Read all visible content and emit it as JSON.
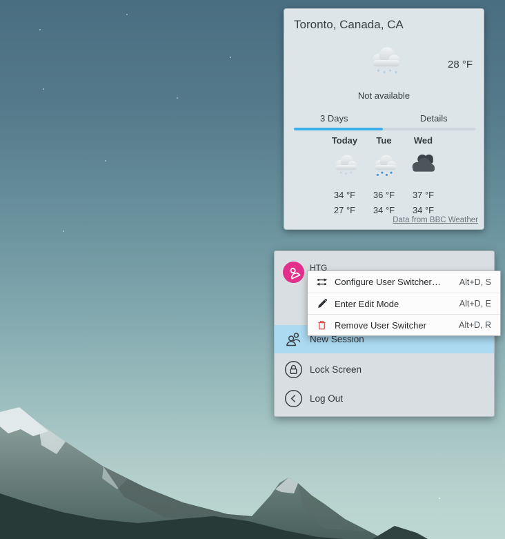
{
  "wallpaper": {
    "sky_top_color": "#4a6e81",
    "sky_bottom_color": "#bed7d3"
  },
  "weather": {
    "title": "Toronto, Canada, CA",
    "accent": "#3daee9",
    "current": {
      "icon": "snow-cloud-icon",
      "temperature": "28 °F",
      "condition": "Not available"
    },
    "tabs": [
      {
        "label": "3 Days",
        "active": true
      },
      {
        "label": "Details",
        "active": false
      }
    ],
    "forecast": [
      {
        "day": "Today",
        "icon": "light-snow-cloud-icon",
        "high": "34 °F",
        "low": "27 °F"
      },
      {
        "day": "Tue",
        "icon": "snow-cloud-icon",
        "high": "36 °F",
        "low": "34 °F"
      },
      {
        "day": "Wed",
        "icon": "dark-clouds-icon",
        "high": "37 °F",
        "low": "34 °F"
      }
    ],
    "attribution": "Data from BBC Weather"
  },
  "user_switcher": {
    "user": {
      "name": "HTG",
      "avatar_color": "#e0308c",
      "avatar_icon": "user-icon"
    },
    "highlight_color": "#abdaf1",
    "items": [
      {
        "label": "New Session",
        "icon": "new-session-icon",
        "highlighted": true
      },
      {
        "label": "Lock Screen",
        "icon": "lock-icon",
        "highlighted": false
      },
      {
        "label": "Log Out",
        "icon": "logout-icon",
        "highlighted": false
      }
    ]
  },
  "context_menu": {
    "items": [
      {
        "label": "Configure User Switcher…",
        "icon": "configure-icon",
        "shortcut": "Alt+D, S"
      },
      {
        "label": "Enter Edit Mode",
        "icon": "edit-icon",
        "shortcut": "Alt+D, E"
      },
      {
        "label": "Remove User Switcher",
        "icon": "trash-icon",
        "shortcut": "Alt+D, R",
        "icon_color": "#d24848"
      }
    ]
  }
}
